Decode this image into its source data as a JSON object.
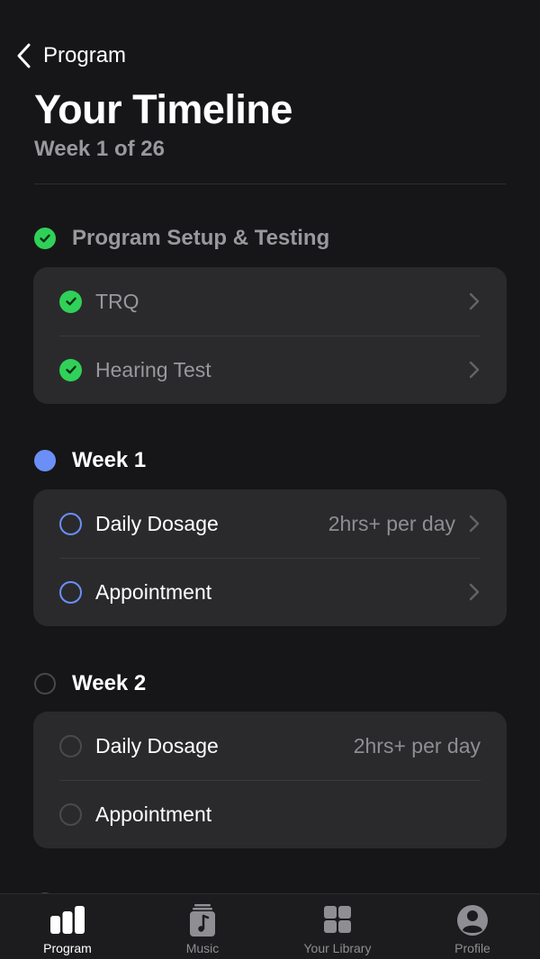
{
  "nav": {
    "back_label": "Program"
  },
  "header": {
    "title": "Your Timeline",
    "subtitle": "Week 1 of 26"
  },
  "sections": [
    {
      "title": "Program Setup & Testing",
      "status": "done",
      "items": [
        {
          "label": "TRQ",
          "value": "",
          "status": "done"
        },
        {
          "label": "Hearing Test",
          "value": "",
          "status": "done"
        }
      ]
    },
    {
      "title": "Week 1",
      "status": "current",
      "items": [
        {
          "label": "Daily Dosage",
          "value": "2hrs+ per day",
          "status": "current"
        },
        {
          "label": "Appointment",
          "value": "",
          "status": "current"
        }
      ]
    },
    {
      "title": "Week 2",
      "status": "pending",
      "items": [
        {
          "label": "Daily Dosage",
          "value": "2hrs+ per day",
          "status": "pending"
        },
        {
          "label": "Appointment",
          "value": "",
          "status": "pending"
        }
      ]
    }
  ],
  "tabbar": {
    "tabs": [
      {
        "label": "Program",
        "icon": "bar-chart-icon",
        "active": true
      },
      {
        "label": "Music",
        "icon": "music-note-icon",
        "active": false
      },
      {
        "label": "Your Library",
        "icon": "grid-icon",
        "active": false
      },
      {
        "label": "Profile",
        "icon": "person-icon",
        "active": false
      }
    ]
  },
  "colors": {
    "background": "#161618",
    "card": "#2a2a2c",
    "done": "#30d158",
    "current": "#6b8ff7",
    "muted_text": "#98989d"
  }
}
